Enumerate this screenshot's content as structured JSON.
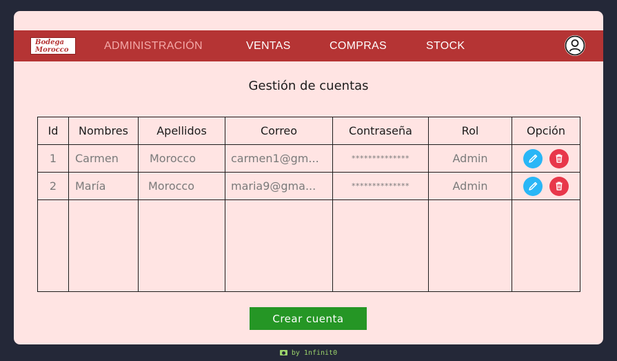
{
  "logo": {
    "line1": "Bodega",
    "line2": "Morocco"
  },
  "nav": {
    "items": [
      {
        "label": "ADMINISTRACIÓN",
        "active": true
      },
      {
        "label": "VENTAS",
        "active": false
      },
      {
        "label": "COMPRAS",
        "active": false
      },
      {
        "label": "STOCK",
        "active": false
      }
    ],
    "user_icon": "user-circle-icon"
  },
  "page": {
    "title": "Gestión de cuentas"
  },
  "table": {
    "headers": [
      "Id",
      "Nombres",
      "Apellidos",
      "Correo",
      "Contraseña",
      "Rol",
      "Opción"
    ],
    "rows": [
      {
        "id": "1",
        "nombres": "Carmen",
        "apellidos": "Morocco",
        "correo": "carmen1@gm...",
        "contrasena": "**************",
        "rol": "Admin"
      },
      {
        "id": "2",
        "nombres": "María",
        "apellidos": "Morocco",
        "correo": "maria9@gma...",
        "contrasena": "**************",
        "rol": "Admin"
      }
    ],
    "option_icons": {
      "edit": "pencil-icon",
      "delete": "trash-icon"
    }
  },
  "actions": {
    "create_label": "Crear cuenta"
  },
  "credit": {
    "text": "by 1nfinit0"
  },
  "colors": {
    "navbar": "#b53434",
    "background": "#ffe4e3",
    "create": "#259625",
    "edit": "#29b6f6",
    "delete": "#e8374a"
  }
}
